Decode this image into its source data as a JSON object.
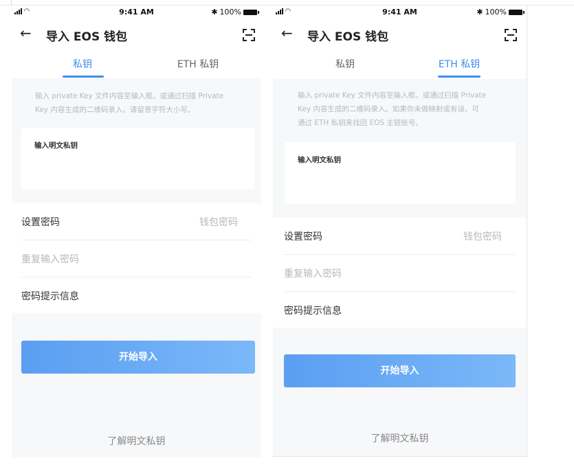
{
  "status_bar": {
    "time": "9:41 AM",
    "battery": "100%"
  },
  "colors": {
    "accent": "#3b8ef0",
    "button_start": "#5b9ef2",
    "button_end": "#7ab8f8",
    "page_bg": "#f7f8fa"
  },
  "screens": [
    {
      "title": "导入 EOS 钱包",
      "tabs": [
        "私钥",
        "ETH 私钥"
      ],
      "active_tab": 0,
      "description_lines": [
        "输入 private Key 文件内容至输入框。或通过扫描 Private",
        "Key 内容生成的二维码录入。请留意字符大小写。"
      ],
      "input_label": "输入明文私钥",
      "password_label": "设置密码",
      "password_placeholder": "钱包密码",
      "repeat_placeholder": "重复输入密码",
      "hint_label": "密码提示信息",
      "submit_label": "开始导入",
      "learn_link": "了解明文私钥"
    },
    {
      "title": "导入 EOS 钱包",
      "tabs": [
        "私钥",
        "ETH 私钥"
      ],
      "active_tab": 1,
      "description_lines": [
        "输入 private Key 文件内容至输入框。或通过扫描 Private",
        "Key 内容生成的二维码录入。如果你未做映射或有误，可",
        "通过 ETH 私钥来找回 EOS 主链账号。"
      ],
      "input_label": "输入明文私钥",
      "password_label": "设置密码",
      "password_placeholder": "钱包密码",
      "repeat_placeholder": "重复输入密码",
      "hint_label": "密码提示信息",
      "submit_label": "开始导入",
      "learn_link": "了解明文私钥"
    }
  ]
}
